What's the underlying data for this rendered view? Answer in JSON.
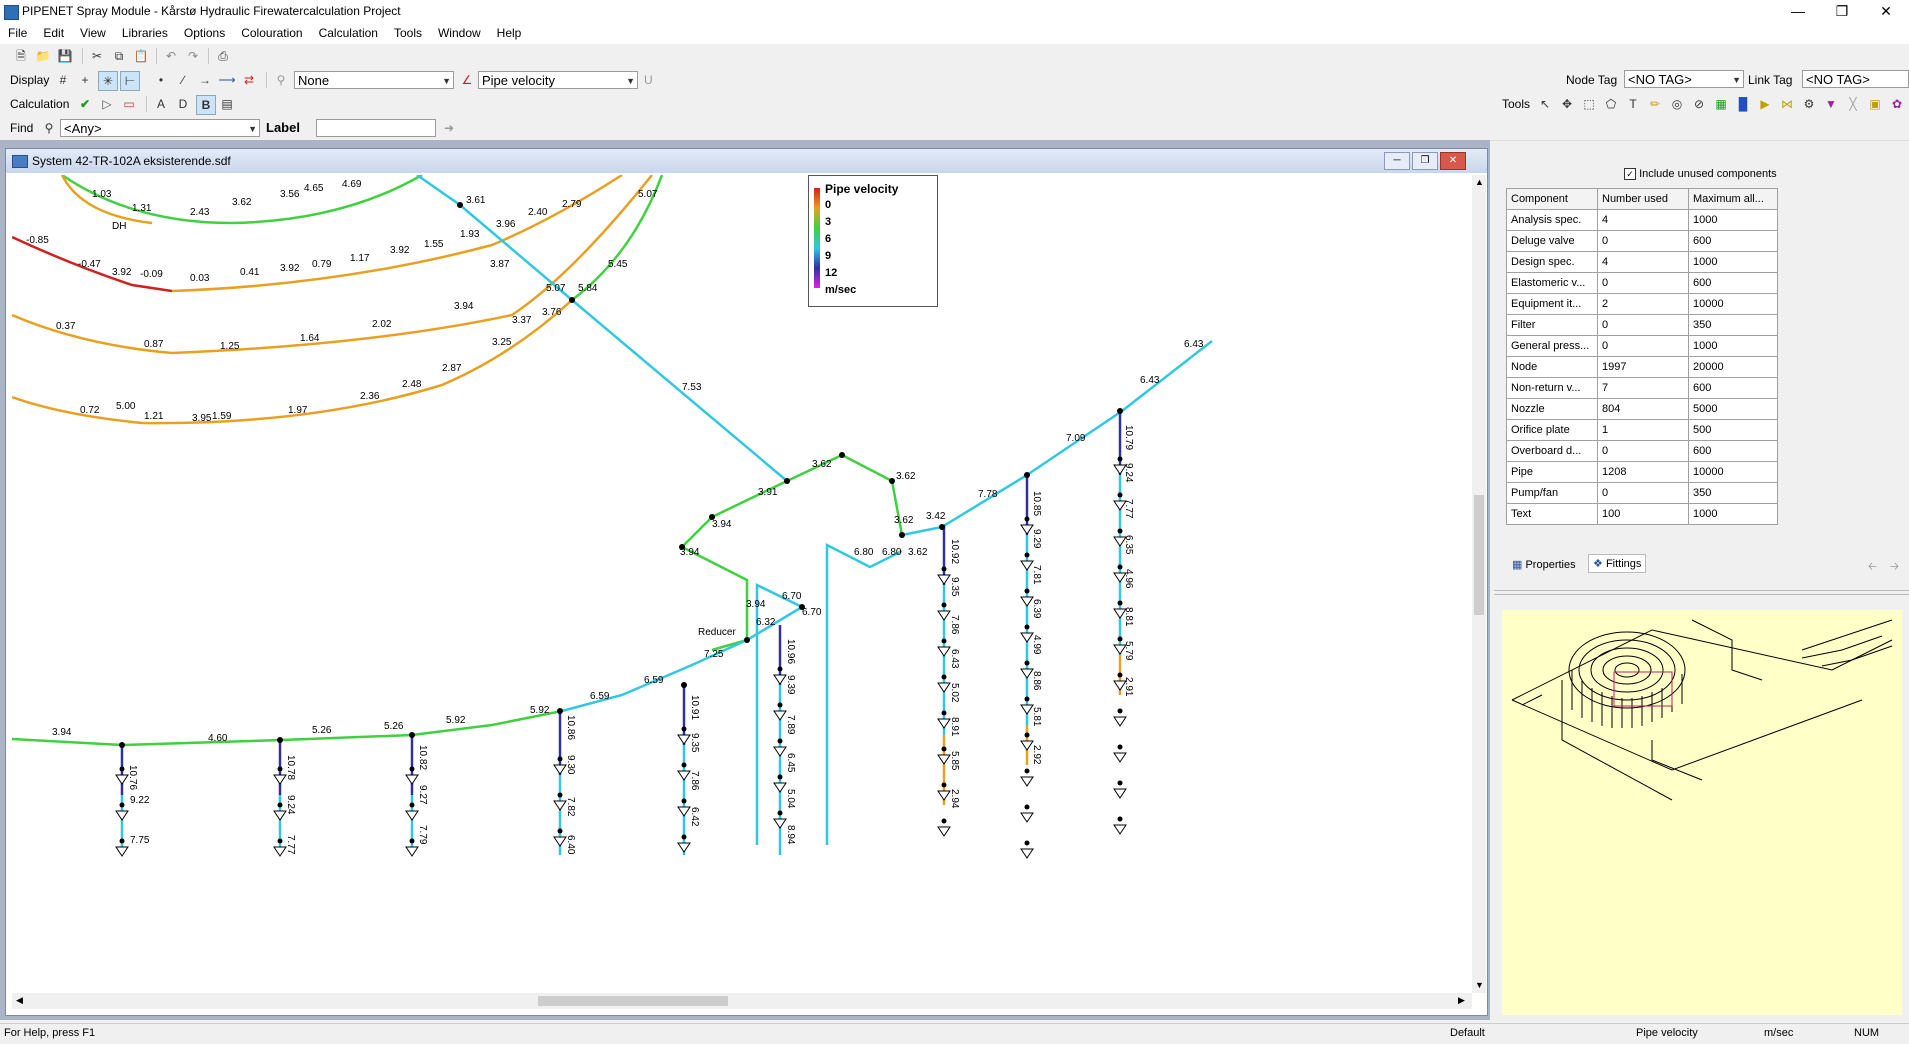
{
  "app": {
    "title": "PIPENET Spray Module - Kårstø Hydraulic Firewatercalculation Project"
  },
  "menu": [
    "File",
    "Edit",
    "View",
    "Libraries",
    "Options",
    "Colouration",
    "Calculation",
    "Tools",
    "Window",
    "Help"
  ],
  "toolbar": {
    "display_label": "Display",
    "node_colour_value": "None",
    "link_colour_value": "Pipe velocity",
    "u_label": "U",
    "node_tag_label": "Node Tag",
    "node_tag_value": "<NO TAG>",
    "link_tag_label": "Link Tag",
    "link_tag_value": "<NO TAG>",
    "calculation_label": "Calculation",
    "tools_label": "Tools",
    "find_label": "Find",
    "find_value": "<Any>",
    "label_label": "Label",
    "label_value": ""
  },
  "document": {
    "title": "System 42-TR-102A eksisterende.sdf"
  },
  "legend": {
    "title": "Pipe velocity",
    "unit": "m/sec",
    "entries": [
      {
        "label": "0",
        "color": "#e8a020"
      },
      {
        "label": "3",
        "color": "#e8a020"
      },
      {
        "label": "6",
        "color": "#40d040"
      },
      {
        "label": "9",
        "color": "#30c8e0"
      },
      {
        "label": "12",
        "color": "#3030a0"
      }
    ],
    "bar_colors": [
      "#d02020",
      "#e8a020",
      "#40d040",
      "#30c8e0",
      "#3030a0",
      "#e020e0"
    ]
  },
  "drawing_labels": [
    "1.03",
    "1.31",
    "2.43",
    "3.62",
    "3.56",
    "4.65",
    "4.69",
    "-0.85",
    "-0.47",
    "3.92",
    "-0.09",
    "0.03",
    "0.41",
    "3.92",
    "0.79",
    "1.17",
    "3.92",
    "1.55",
    "1.93",
    "3.96",
    "2.40",
    "2.79",
    "3.87",
    "3.61",
    "5.07",
    "5.84",
    "5.45",
    "5.07",
    "0.37",
    "0.87",
    "1.25",
    "1.64",
    "2.02",
    "3.94",
    "3.25",
    "3.37",
    "3.76",
    "0.72",
    "1.21",
    "1.59",
    "1.97",
    "2.36",
    "2.48",
    "2.87",
    "5.00",
    "3.95",
    "7.53",
    "6.43",
    "6.43",
    "7.09",
    "7.78",
    "3.62",
    "3.62",
    "3.91",
    "3.94",
    "3.94",
    "3.94",
    "3.62",
    "6.80",
    "6.80",
    "3.62",
    "3.42",
    "6.70",
    "6.70",
    "6.32",
    "7.25",
    "6.59",
    "6.59",
    "5.92",
    "5.92",
    "5.26",
    "5.26",
    "4.60",
    "3.94",
    "10.92",
    "9.35",
    "7.86",
    "6.43",
    "5.02",
    "8.91",
    "5.85",
    "2.94",
    "10.85",
    "9.29",
    "7.81",
    "6.39",
    "4.99",
    "8.86",
    "5.81",
    "2.92",
    "10.79",
    "9.24",
    "7.77",
    "6.35",
    "4.96",
    "8.81",
    "5.79",
    "2.91",
    "10.96",
    "9.39",
    "7.89",
    "6.45",
    "5.04",
    "8.94",
    "10.91",
    "9.35",
    "7.86",
    "6.42",
    "10.86",
    "9.30",
    "7.82",
    "6.40",
    "10.82",
    "9.27",
    "7.79",
    "10.78",
    "9.24",
    "7.77",
    "10.76",
    "9.22",
    "7.75",
    "DH",
    "Reducer"
  ],
  "components": {
    "checkbox_label": "Include unused components",
    "headers": [
      "Component",
      "Number used",
      "Maximum all..."
    ],
    "rows": [
      [
        "Analysis spec.",
        "4",
        "1000"
      ],
      [
        "Deluge valve",
        "0",
        "600"
      ],
      [
        "Design spec.",
        "4",
        "1000"
      ],
      [
        "Elastomeric v...",
        "0",
        "600"
      ],
      [
        "Equipment it...",
        "2",
        "10000"
      ],
      [
        "Filter",
        "0",
        "350"
      ],
      [
        "General press...",
        "0",
        "1000"
      ],
      [
        "Node",
        "1997",
        "20000"
      ],
      [
        "Non-return v...",
        "7",
        "600"
      ],
      [
        "Nozzle",
        "804",
        "5000"
      ],
      [
        "Orifice plate",
        "1",
        "500"
      ],
      [
        "Overboard d...",
        "0",
        "600"
      ],
      [
        "Pipe",
        "1208",
        "10000"
      ],
      [
        "Pump/fan",
        "0",
        "350"
      ],
      [
        "Text",
        "100",
        "1000"
      ]
    ]
  },
  "panel_tabs": {
    "properties": "Properties",
    "fittings": "Fittings"
  },
  "status": {
    "help": "For Help, press F1",
    "mode": "Default",
    "colour": "Pipe velocity",
    "unit": "m/sec",
    "num": "NUM"
  }
}
